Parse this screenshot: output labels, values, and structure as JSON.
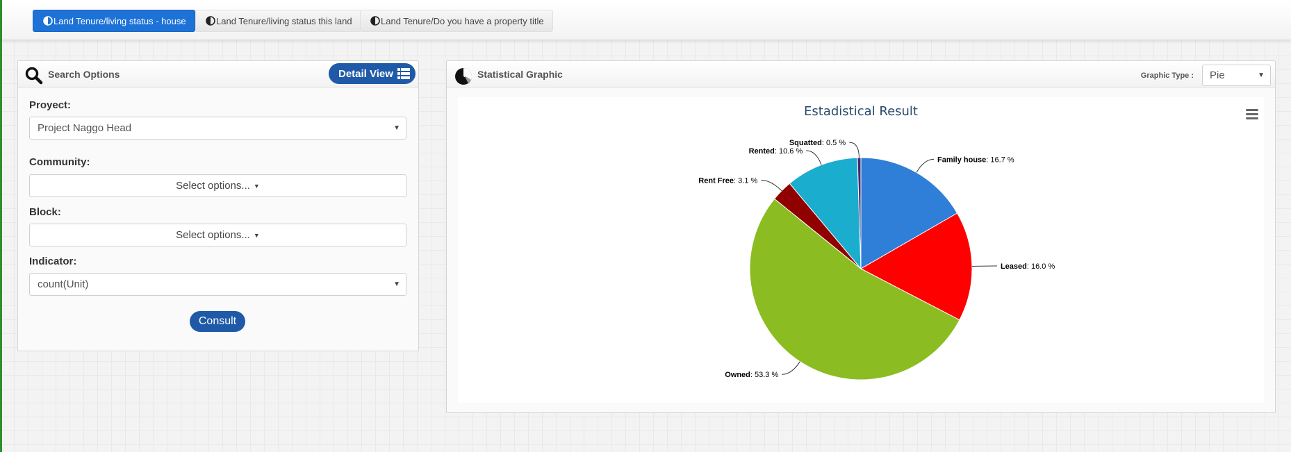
{
  "tabs": [
    {
      "label": "Land Tenure/living status - house",
      "active": true
    },
    {
      "label": "Land Tenure/living status this land",
      "active": false
    },
    {
      "label": "Land Tenure/Do you have a property title",
      "active": false
    }
  ],
  "search_panel": {
    "title": "Search Options",
    "detail_view_label": "Detail View",
    "fields": {
      "project": {
        "label": "Proyect:",
        "value": "Project Naggo Head"
      },
      "community": {
        "label": "Community:",
        "value": "Select options..."
      },
      "block": {
        "label": "Block:",
        "value": "Select options..."
      },
      "indicator": {
        "label": "Indicator:",
        "value": "count(Unit)"
      }
    },
    "consult_label": "Consult"
  },
  "graphic_panel": {
    "title": "Statistical Graphic",
    "graphic_type_label": "Graphic Type :",
    "graphic_type_value": "Pie"
  },
  "chart_data": {
    "type": "pie",
    "title": "Estadistical Result",
    "slices": [
      {
        "name": "Family house",
        "value": 16.7,
        "label": ": 16.7 %",
        "color": "#2f7ed8"
      },
      {
        "name": "Leased",
        "value": 16.0,
        "label": ": 16.0 %",
        "color": "#ff0000"
      },
      {
        "name": "Owned",
        "value": 53.3,
        "label": ": 53.3 %",
        "color": "#8bbc21"
      },
      {
        "name": "Rent Free",
        "value": 3.1,
        "label": ": 3.1 %",
        "color": "#910000"
      },
      {
        "name": "Rented",
        "value": 10.6,
        "label": ": 10.6 %",
        "color": "#1aadce"
      },
      {
        "name": "Squatted",
        "value": 0.5,
        "label": ": 0.5 %",
        "color": "#492970"
      }
    ]
  },
  "colors": {
    "accent": "#1f5aa8",
    "active_tab": "#1d72d8"
  }
}
